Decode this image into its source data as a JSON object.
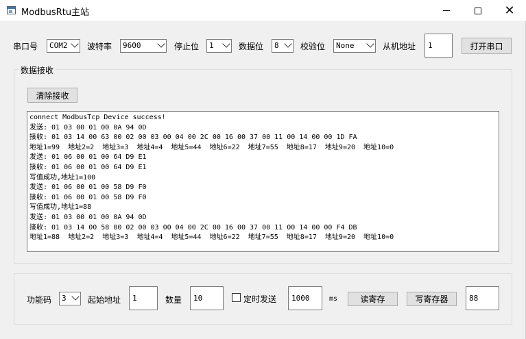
{
  "window": {
    "title": "ModbusRtu主站",
    "min_label": "",
    "max_label": "",
    "close_label": "✕"
  },
  "serial": {
    "port_label": "串口号",
    "port_value": "COM2",
    "baud_label": "波特率",
    "baud_value": "9600",
    "stopbits_label": "停止位",
    "stopbits_value": "1",
    "databits_label": "数据位",
    "databits_value": "8",
    "parity_label": "校验位",
    "parity_value": "None",
    "slave_label": "从机地址",
    "slave_value": "1",
    "open_button": "打开串口"
  },
  "receive": {
    "group_title": "数据接收",
    "clear_button": "清除接收",
    "log": [
      "connect ModbusTcp Device success!",
      "发送: 01 03 00 01 00 0A 94 0D",
      "接收: 01 03 14 00 63 00 02 00 03 00 04 00 2C 00 16 00 37 00 11 00 14 00 00 1D FA",
      "地址1=99  地址2=2  地址3=3  地址4=4  地址5=44  地址6=22  地址7=55  地址8=17  地址9=20  地址10=0",
      "发送: 01 06 00 01 00 64 D9 E1",
      "接收: 01 06 00 01 00 64 D9 E1",
      "写值成功,地址1=100",
      "发送: 01 06 00 01 00 58 D9 F0",
      "接收: 01 06 00 01 00 58 D9 F0",
      "写值成功,地址1=88",
      "发送: 01 03 00 01 00 0A 94 0D",
      "接收: 01 03 14 00 58 00 02 00 03 00 04 00 2C 00 16 00 37 00 11 00 14 00 00 F4 DB",
      "地址1=88  地址2=2  地址3=3  地址4=4  地址5=44  地址6=22  地址7=55  地址8=17  地址9=20  地址10=0"
    ]
  },
  "control": {
    "func_label": "功能码",
    "func_value": "3",
    "start_label": "起始地址",
    "start_value": "1",
    "count_label": "数量",
    "count_value": "10",
    "timed_label": "定时发送",
    "timed_checked": false,
    "interval_value": "1000",
    "interval_unit": "ms",
    "read_button": "读寄存",
    "write_button": "写寄存器",
    "write_value": "88"
  }
}
